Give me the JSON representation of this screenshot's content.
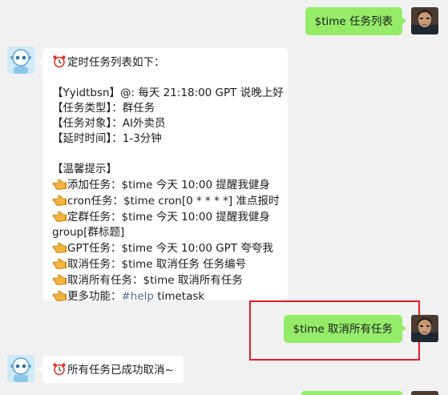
{
  "messages": {
    "m1": {
      "text": "$time 任务列表"
    },
    "m2": {
      "title": "定时任务列表如下：",
      "task_line": "【Yyidtbsn】@: 每天 21:18:00 GPT 说晚上好",
      "type_line": "【任务类型】：群任务",
      "target_line": "【任务对象】：AI外卖员",
      "delay_line": "【延时时间】：1-3分钟",
      "tips_title": "【温馨提示】",
      "tips": [
        "添加任务：$time 今天 10:00 提醒我健身",
        "cron任务：$time cron[0 * * * *] 准点报时",
        "定群任务：$time 今天 10:00 提醒我健身",
        "GPT任务：$time 今天 10:00 GPT 夸夸我",
        "取消任务：$time 取消任务 任务编号",
        "取消所有任务：$time 取消所有任务"
      ],
      "tip3_cont": "group[群标题]",
      "more_prefix": "更多功能：",
      "more_tag": "#help",
      "more_suffix": " timetask"
    },
    "m3": {
      "text": "$time 取消所有任务"
    },
    "m4": {
      "text": "所有任务已成功取消~"
    }
  },
  "colors": {
    "background": "#f1f1f1",
    "my_bubble": "#95ec69",
    "bot_bubble": "#ffffff",
    "link": "#576b95",
    "highlight": "#e21d23"
  },
  "icons": {
    "alarm": "alarm-clock-icon",
    "pointer": "pointing-hand-icon"
  }
}
